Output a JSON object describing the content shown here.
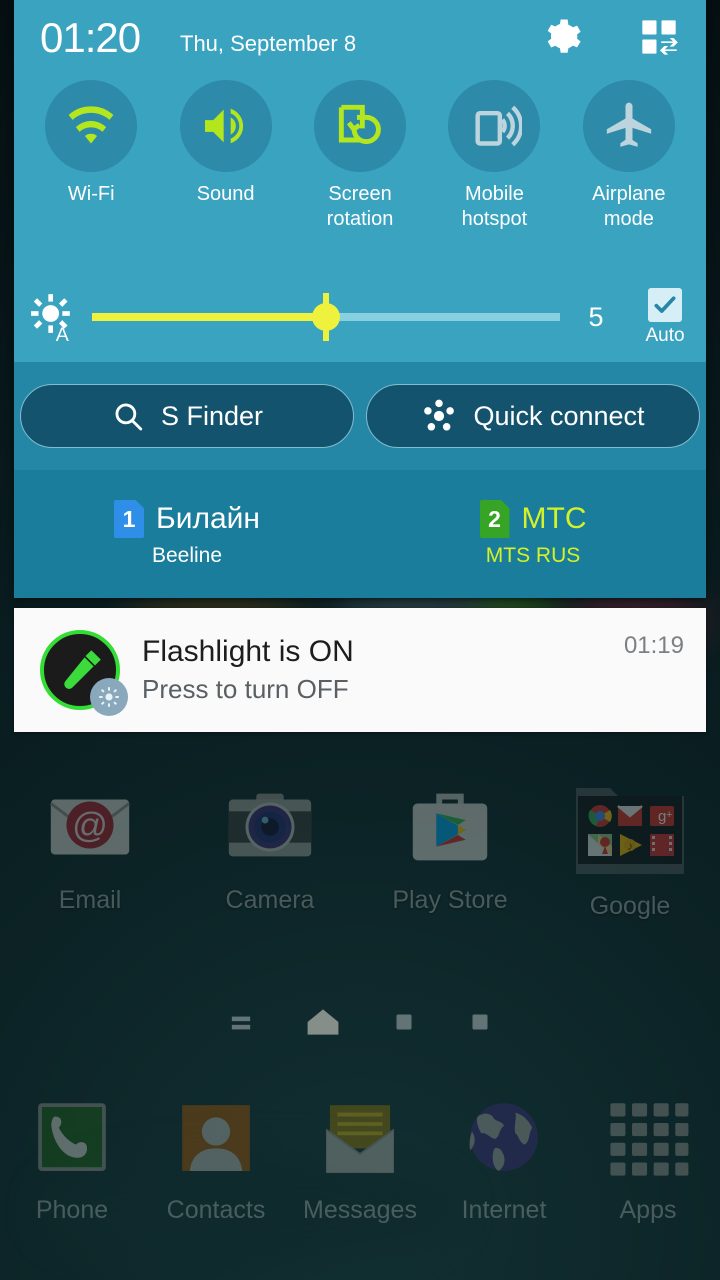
{
  "statusbar": {
    "time": "01:20",
    "date": "Thu, September 8"
  },
  "quick_settings": {
    "settings_icon": "gear-icon",
    "edit_icon": "edit-quick-settings-icon",
    "toggles": [
      {
        "label": "Wi-Fi",
        "icon": "wifi-icon",
        "active": true
      },
      {
        "label": "Sound",
        "icon": "sound-icon",
        "active": true
      },
      {
        "label": "Screen\nrotation",
        "label_line1": "Screen",
        "label_line2": "rotation",
        "icon": "screen-rotation-icon",
        "active": true
      },
      {
        "label": "Mobile\nhotspot",
        "label_line1": "Mobile",
        "label_line2": "hotspot",
        "icon": "mobile-hotspot-icon",
        "active": false
      },
      {
        "label": "Airplane\nmode",
        "label_line1": "Airplane",
        "label_line2": "mode",
        "icon": "airplane-mode-icon",
        "active": false
      }
    ],
    "brightness": {
      "icon": "auto-brightness-icon",
      "value": "5",
      "percent": 50,
      "auto_label": "Auto",
      "auto_checked": true
    },
    "shortcuts": [
      {
        "label": "S Finder",
        "icon": "search-icon"
      },
      {
        "label": "Quick connect",
        "icon": "quick-connect-icon"
      }
    ],
    "sims": [
      {
        "slot": "1",
        "name": "Билайн",
        "operator": "Beeline",
        "badge_color": "#2f8fe8",
        "text_color": "#ffffff",
        "active": false
      },
      {
        "slot": "2",
        "name": "МТС",
        "operator": "MTS RUS",
        "badge_color": "#36a424",
        "text_color": "#d4f227",
        "active": true
      }
    ]
  },
  "notification": {
    "icon": "flashlight-icon",
    "badge_icon": "brightness-badge-icon",
    "title": "Flashlight is ON",
    "subtitle": "Press to turn OFF",
    "time": "01:19"
  },
  "homescreen": {
    "apps": [
      {
        "label": "Email",
        "icon": "email-icon"
      },
      {
        "label": "Camera",
        "icon": "camera-icon"
      },
      {
        "label": "Play Store",
        "icon": "play-store-icon"
      },
      {
        "label": "Google",
        "icon": "google-folder-icon"
      }
    ],
    "folder_items": [
      "chrome-icon",
      "gmail-icon",
      "google-plus-icon",
      "maps-icon",
      "play-music-icon",
      "play-movies-icon"
    ],
    "page_indicators": [
      {
        "icon": "widgets-page-icon",
        "current": false
      },
      {
        "icon": "home-page-icon",
        "current": true
      },
      {
        "icon": "page-dot-icon",
        "current": false
      },
      {
        "icon": "page-dot-icon",
        "current": false
      }
    ],
    "dock": [
      {
        "label": "Phone",
        "icon": "phone-icon"
      },
      {
        "label": "Contacts",
        "icon": "contacts-icon"
      },
      {
        "label": "Messages",
        "icon": "messages-icon"
      },
      {
        "label": "Internet",
        "icon": "internet-icon"
      },
      {
        "label": "Apps",
        "icon": "apps-grid-icon"
      }
    ]
  },
  "colors": {
    "panel_bg": "#3aa3c0",
    "toggle_circle": "#2d8aa8",
    "accent_lime": "#b4e61e",
    "slider_fill": "#eef23c",
    "inactive_icon": "#bcd4dd",
    "notif_bg": "#fafafa"
  }
}
